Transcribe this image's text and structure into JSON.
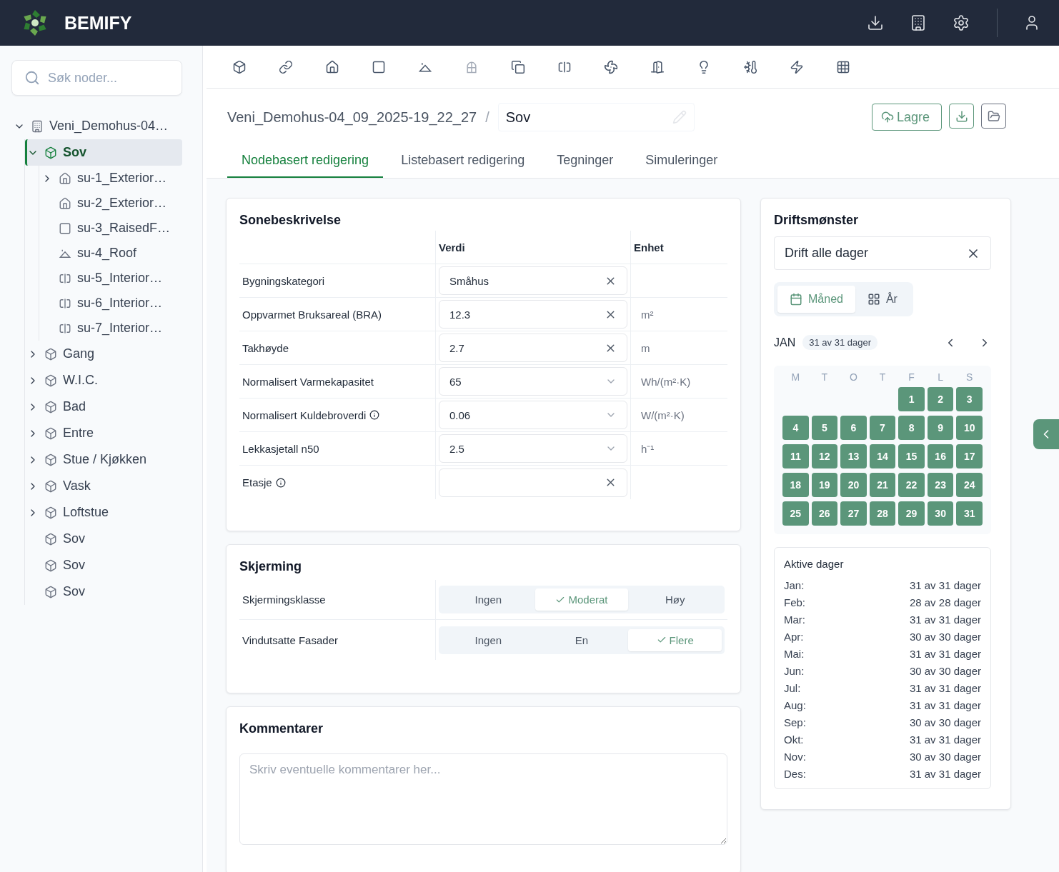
{
  "header": {
    "brand": "BEMIFY"
  },
  "sidebar": {
    "search": {
      "placeholder": "Søk noder..."
    },
    "tree": [
      {
        "label": "Veni_Demohus-04…",
        "kind": "building",
        "expanded": true,
        "selected": false,
        "children": [
          {
            "label": "Sov",
            "kind": "zone",
            "expanded": true,
            "selected": true,
            "children": [
              {
                "label": "su-1_Exterior…",
                "kind": "wall",
                "expanded": false,
                "selected": false
              },
              {
                "label": "su-2_Exterior…",
                "kind": "wall",
                "selected": false
              },
              {
                "label": "su-3_RaisedF…",
                "kind": "floor",
                "selected": false
              },
              {
                "label": "su-4_Roof",
                "kind": "roof",
                "selected": false
              },
              {
                "label": "su-5_Interior…",
                "kind": "interior",
                "selected": false
              },
              {
                "label": "su-6_Interior…",
                "kind": "interior",
                "selected": false
              },
              {
                "label": "su-7_Interior…",
                "kind": "interior",
                "selected": false
              }
            ]
          },
          {
            "label": "Gang",
            "kind": "zone",
            "expanded": false,
            "selected": false
          },
          {
            "label": "W.I.C.",
            "kind": "zone",
            "expanded": false,
            "selected": false
          },
          {
            "label": "Bad",
            "kind": "zone",
            "expanded": false,
            "selected": false
          },
          {
            "label": "Entre",
            "kind": "zone",
            "expanded": false,
            "selected": false
          },
          {
            "label": "Stue / Kjøkken",
            "kind": "zone",
            "expanded": false,
            "selected": false
          },
          {
            "label": "Vask",
            "kind": "zone",
            "expanded": false,
            "selected": false
          },
          {
            "label": "Loftstue",
            "kind": "zone",
            "expanded": false,
            "selected": false
          },
          {
            "label": "Sov",
            "kind": "zone",
            "selected": false
          },
          {
            "label": "Sov",
            "kind": "zone",
            "selected": false
          },
          {
            "label": "Sov",
            "kind": "zone",
            "selected": false
          }
        ]
      }
    ]
  },
  "toolbar": [
    {
      "kind": "zone",
      "disabled": false
    },
    {
      "kind": "link",
      "disabled": false
    },
    {
      "kind": "wall",
      "disabled": false
    },
    {
      "kind": "floor",
      "disabled": false
    },
    {
      "kind": "roof",
      "disabled": false
    },
    {
      "kind": "window",
      "disabled": true
    },
    {
      "kind": "copy",
      "disabled": false
    },
    {
      "kind": "interior",
      "disabled": false
    },
    {
      "kind": "fan",
      "disabled": false
    },
    {
      "kind": "door",
      "disabled": false
    },
    {
      "kind": "light",
      "disabled": false
    },
    {
      "kind": "thermo",
      "disabled": false
    },
    {
      "kind": "power",
      "disabled": false
    },
    {
      "kind": "solar",
      "disabled": false
    }
  ],
  "breadcrumb": {
    "path": "Veni_Demohus-04_09_2025-19_22_27",
    "separator": "/",
    "name": "Sov"
  },
  "save_button": "Lagre",
  "tabs": [
    {
      "label": "Nodebasert redigering",
      "selected": true
    },
    {
      "label": "Listebasert redigering",
      "selected": false
    },
    {
      "label": "Tegninger",
      "selected": false
    },
    {
      "label": "Simuleringer",
      "selected": false
    }
  ],
  "zone_description": {
    "title": "Sonebeskrivelse",
    "columns": [
      "Verdi",
      "Enhet"
    ],
    "rows": [
      {
        "label": "Bygningskategori",
        "info": false,
        "value": "Småhus",
        "kind": "clear"
      },
      {
        "label": "Oppvarmet Bruksareal (BRA)",
        "info": false,
        "value": "12.3",
        "kind": "clear",
        "unit": "m²"
      },
      {
        "label": "Takhøyde",
        "info": false,
        "value": "2.7",
        "kind": "clear",
        "unit": "m"
      },
      {
        "label": "Normalisert Varmekapasitet",
        "info": false,
        "value": "65",
        "kind": "select",
        "unit": "Wh/(m²·K)"
      },
      {
        "label": "Normalisert Kuldebroverdi",
        "info": true,
        "value": "0.06",
        "kind": "select",
        "unit": "W/(m²·K)"
      },
      {
        "label": "Lekkasjetall n50",
        "info": false,
        "value": "2.5",
        "kind": "select",
        "unit": "h⁻¹"
      },
      {
        "label": "Etasje",
        "info": true,
        "kind": "clear"
      }
    ]
  },
  "shading": {
    "title": "Skjerming",
    "rows": [
      {
        "label": "Skjermingsklasse",
        "options": [
          {
            "label": "Ingen",
            "selected": false
          },
          {
            "label": "Moderat",
            "selected": true
          },
          {
            "label": "Høy",
            "selected": false
          }
        ]
      },
      {
        "label": "Vindutsatte Fasader",
        "options": [
          {
            "label": "Ingen",
            "selected": false
          },
          {
            "label": "En",
            "selected": false
          },
          {
            "label": "Flere",
            "selected": true
          }
        ]
      }
    ]
  },
  "comments": {
    "title": "Kommentarer",
    "placeholder": "Skriv eventuelle kommentarer her..."
  },
  "schedule": {
    "title": "Driftsmønster",
    "value": "Drift alle dager",
    "views": [
      {
        "label": "Måned",
        "kind": "month",
        "selected": true
      },
      {
        "label": "År",
        "kind": "year",
        "selected": false
      }
    ],
    "month": "JAN",
    "month_count": "31 av 31 dager",
    "weekdays": [
      "M",
      "T",
      "O",
      "T",
      "F",
      "L",
      "S"
    ],
    "weeks": [
      [
        {
          "kind": "empty"
        },
        {
          "kind": "empty"
        },
        {
          "kind": "empty"
        },
        {
          "kind": "empty"
        },
        {
          "label": "1",
          "active": true
        },
        {
          "label": "2",
          "active": true
        },
        {
          "label": "3",
          "active": true
        }
      ],
      [
        {
          "label": "4",
          "active": true
        },
        {
          "label": "5",
          "active": true
        },
        {
          "label": "6",
          "active": true
        },
        {
          "label": "7",
          "active": true
        },
        {
          "label": "8",
          "active": true
        },
        {
          "label": "9",
          "active": true
        },
        {
          "label": "10",
          "active": true
        }
      ],
      [
        {
          "label": "11",
          "active": true
        },
        {
          "label": "12",
          "active": true
        },
        {
          "label": "13",
          "active": true
        },
        {
          "label": "14",
          "active": true
        },
        {
          "label": "15",
          "active": true
        },
        {
          "label": "16",
          "active": true
        },
        {
          "label": "17",
          "active": true
        }
      ],
      [
        {
          "label": "18",
          "active": true
        },
        {
          "label": "19",
          "active": true
        },
        {
          "label": "20",
          "active": true
        },
        {
          "label": "21",
          "active": true
        },
        {
          "label": "22",
          "active": true
        },
        {
          "label": "23",
          "active": true
        },
        {
          "label": "24",
          "active": true
        }
      ],
      [
        {
          "label": "25",
          "active": true
        },
        {
          "label": "26",
          "active": true
        },
        {
          "label": "27",
          "active": true
        },
        {
          "label": "28",
          "active": true
        },
        {
          "label": "29",
          "active": true
        },
        {
          "label": "30",
          "active": true
        },
        {
          "label": "31",
          "active": true
        }
      ]
    ],
    "summary_title": "Aktive dager",
    "summary": [
      {
        "month": "Jan:",
        "value": "31 av 31 dager"
      },
      {
        "month": "Feb:",
        "value": "28 av 28 dager"
      },
      {
        "month": "Mar:",
        "value": "31 av 31 dager"
      },
      {
        "month": "Apr:",
        "value": "30 av 30 dager"
      },
      {
        "month": "Mai:",
        "value": "31 av 31 dager"
      },
      {
        "month": "Jun:",
        "value": "30 av 30 dager"
      },
      {
        "month": "Jul:",
        "value": "31 av 31 dager"
      },
      {
        "month": "Aug:",
        "value": "31 av 31 dager"
      },
      {
        "month": "Sep:",
        "value": "30 av 30 dager"
      },
      {
        "month": "Okt:",
        "value": "31 av 31 dager"
      },
      {
        "month": "Nov:",
        "value": "30 av 30 dager"
      },
      {
        "month": "Des:",
        "value": "31 av 31 dager"
      }
    ]
  }
}
